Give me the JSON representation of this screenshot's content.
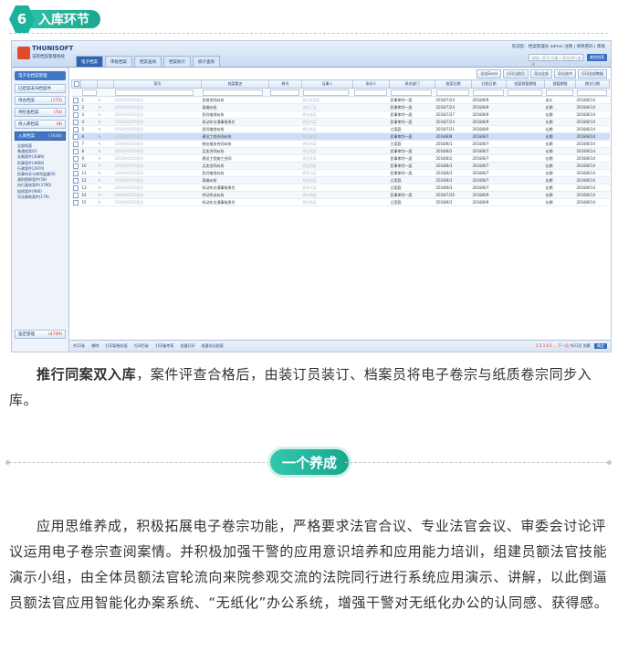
{
  "section": {
    "number": "6",
    "title": "入库环节"
  },
  "app": {
    "logo_name": "THUNISOFT",
    "logo_sub": "法院档案管理系统",
    "top_info": "欢迎您：档案管理员  admin  注销 | 修改密码 | 帮助",
    "tabs": [
      "电子档案",
      "审批档案",
      "档案查阅",
      "档案统计",
      "统计查询"
    ],
    "search_placeholder": "请输入案号/当事人/案由进行查询",
    "search_button": "查找档案"
  },
  "sidebar": {
    "top": "电子化档案管理",
    "items": [
      {
        "label": "已结案未归档案件",
        "count": ""
      },
      {
        "label": "待办档案",
        "count": "(775)"
      },
      {
        "label": "待检查档案",
        "count": "(74)"
      },
      {
        "label": "待入库档案",
        "count": "(8)"
      },
      {
        "label": "入库档案",
        "count": "(7648)"
      }
    ],
    "subitems": [
      "全部档案",
      "普通档案(0)",
      "长期案件(3089)",
      "刑事案件(4868)",
      "行政案件(2970)",
      "民事申诉与审判监督(9)",
      "减刑假释案件(58)",
      "执行复核案件(3780)",
      "赔偿案件(960)",
      "司法救助案件(179)"
    ],
    "bottom": {
      "label": "鉴定管理",
      "count": "(4709)"
    }
  },
  "toolbar": [
    "导出Excel",
    "打印当前页",
    "导出全部",
    "导出选中",
    "打印全部数据"
  ],
  "table": {
    "headers": [
      "",
      "",
      "",
      "案号",
      "档案题名",
      "卷号",
      "当事人",
      "承办人",
      "承办部门",
      "收案日期",
      "归档日期",
      "档案保管期限",
      "保管期限",
      "移交日期"
    ],
    "rows": [
      [
        "1",
        "(2018)京0105民初",
        "民商合同纠纷",
        "原告李某某",
        "民事审判一庭",
        "2018/7/24",
        "2018/8/9",
        "永久",
        "2018/8/14"
      ],
      [
        "2",
        "(2018)京0105民初",
        "离婚纠纷",
        "原告王某",
        "民事审判一庭",
        "2018/7/24",
        "2018/8/9",
        "长期",
        "2018/8/14"
      ],
      [
        "3",
        "(2018)京0105民初",
        "民间借贷纠纷",
        "原告张某",
        "民事审判一庭",
        "2018/7/27",
        "2018/8/9",
        "长期",
        "2018/8/14"
      ],
      [
        "4",
        "(2018)京0105民初",
        "机动车交通事故责任",
        "原告刘某",
        "民事审判一庭",
        "2018/7/24",
        "2018/8/9",
        "长期",
        "2018/8/14"
      ],
      [
        "5",
        "(2018)京0105民初",
        "民间借贷纠纷",
        "原告陈某",
        "立案庭",
        "2018/7/21",
        "2018/8/9",
        "长期",
        "2018/8/14"
      ],
      [
        "6",
        "(2018)京0105民初",
        "建设工程合同纠纷",
        "原告赵某",
        "民事审判一庭",
        "2018/8/8",
        "2018/8/7",
        "长期",
        "2018/8/14"
      ],
      [
        "7",
        "(2018)京0105民初",
        "物业服务合同纠纷",
        "原告孙某",
        "立案庭",
        "2018/8/1",
        "2018/8/7",
        "长期",
        "2018/8/14"
      ],
      [
        "8",
        "(2018)京0105民初",
        "买卖合同纠纷",
        "原告周某",
        "民事审判一庭",
        "2018/8/2",
        "2018/8/7",
        "长期",
        "2018/8/14"
      ],
      [
        "9",
        "(2018)京0105民初",
        "建设工程施工合同",
        "原告吴某",
        "民事审判一庭",
        "2018/8/2",
        "2018/8/7",
        "长期",
        "2018/8/14"
      ],
      [
        "10",
        "(2018)京0105民初",
        "买卖合同纠纷",
        "原告郑某",
        "民事审判一庭",
        "2018/8/3",
        "2018/8/7",
        "长期",
        "2018/8/14"
      ],
      [
        "11",
        "(2018)京0105民初",
        "民间借贷纠纷",
        "原告冯某",
        "民事审判一庭",
        "2018/8/3",
        "2018/8/7",
        "长期",
        "2018/8/14"
      ],
      [
        "12",
        "(2018)京0105民初",
        "离婚纠纷",
        "原告何某",
        "立案庭",
        "2018/8/3",
        "2018/8/7",
        "长期",
        "2018/8/14"
      ],
      [
        "13",
        "(2018)京0105民初",
        "机动车交通事故责任",
        "原告许某",
        "立案庭",
        "2018/8/3",
        "2018/8/7",
        "长期",
        "2018/8/14"
      ],
      [
        "14",
        "(2018)京0105民初",
        "劳动争议纠纷",
        "原告韩某",
        "民事审判一庭",
        "2018/7/26",
        "2018/8/9",
        "长期",
        "2018/8/14"
      ],
      [
        "15",
        "(2018)京0105民初",
        "机动车交通事故责任",
        "原告杨某",
        "立案庭",
        "2018/8/1",
        "2018/8/9",
        "长期",
        "2018/8/14"
      ]
    ]
  },
  "pager": {
    "actions": [
      "共15条",
      "删除",
      "打印案卷封面",
      "打印目录",
      "打印备考表",
      "批量打印",
      "批量导出档案"
    ],
    "pages": "1 2 3 4 5 ... 下一页",
    "total": "共21页",
    "jump_label": "到第",
    "go": "确定"
  },
  "paragraph1_bold": "推行同案双入库",
  "paragraph1_rest": "，案件评查合格后，由装订员装订、档案员将电子卷宗与纸质卷宗同步入库。",
  "divider_label": "一个养成",
  "paragraph2": "应用思维养成，积极拓展电子卷宗功能，严格要求法官合议、专业法官会议、审委会讨论评议运用电子卷宗查阅案情。并积极加强干警的应用意识培养和应用能力培训，组建员额法官技能演示小组，由全体员额法官轮流向来院参观交流的法院同行进行系统应用演示、讲解，以此倒逼员额法官应用智能化办案系统、“无纸化”办公系统，增强干警对无纸化办公的认同感、获得感。"
}
